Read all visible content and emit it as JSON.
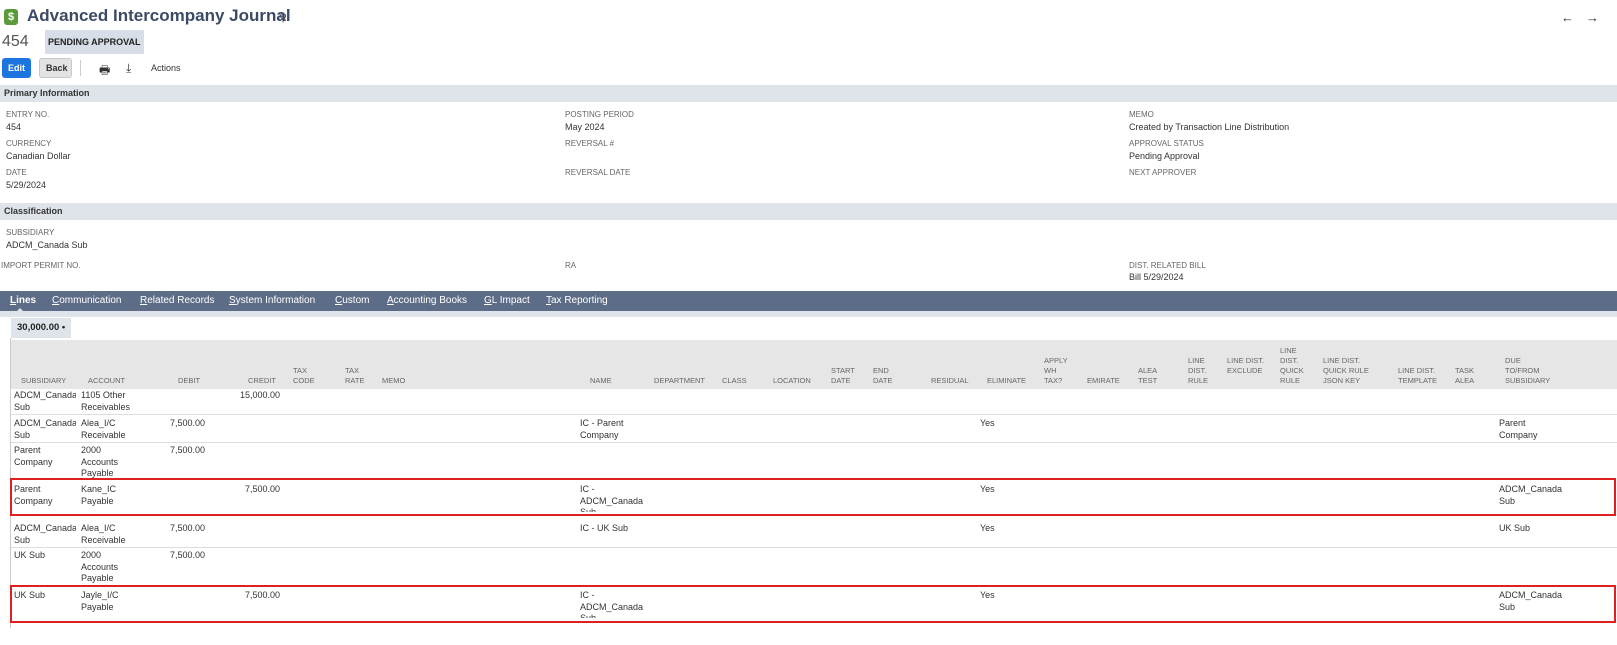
{
  "header": {
    "logo_glyph": "$",
    "title": "Advanced Intercompany Journal",
    "search_glyph": "⚲",
    "nav_arrows": "←→",
    "entry_number": "454",
    "status": "PENDING APPROVAL"
  },
  "toolbar": {
    "edit_label": "Edit",
    "back_label": "Back",
    "print_glyph": "🖶",
    "export_glyph": "⤓",
    "actions_label": "Actions"
  },
  "primary": {
    "section_title": "Primary Information",
    "entry_no_label": "ENTRY NO.",
    "entry_no_value": "454",
    "currency_label": "CURRENCY",
    "currency_value": "Canadian Dollar",
    "date_label": "DATE",
    "date_value": "5/29/2024",
    "posting_period_label": "POSTING PERIOD",
    "posting_period_value": "May 2024",
    "reversal_no_label": "REVERSAL #",
    "reversal_date_label": "REVERSAL DATE",
    "memo_label": "MEMO",
    "memo_value": "Created by Transaction Line Distribution",
    "approval_status_label": "APPROVAL STATUS",
    "approval_status_value": "Pending Approval",
    "next_approver_label": "NEXT APPROVER"
  },
  "classification": {
    "section_title": "Classification",
    "subsidiary_label": "SUBSIDIARY",
    "subsidiary_value": "ADCM_Canada Sub",
    "import_permit_label": "IMPORT PERMIT NO.",
    "ra_label": "RA",
    "dist_bill_label": "DIST. RELATED BILL",
    "dist_bill_value": "Bill 5/29/2024"
  },
  "tabs": [
    {
      "u": "L",
      "rest": "ines"
    },
    {
      "u": "C",
      "rest": "ommunication"
    },
    {
      "u": "R",
      "rest": "elated Records"
    },
    {
      "u": "S",
      "rest": "ystem Information"
    },
    {
      "u": "C",
      "rest": "ustom"
    },
    {
      "u": "A",
      "rest": "ccounting Books"
    },
    {
      "u": "G",
      "rest": "L Impact"
    },
    {
      "u": "T",
      "rest": "ax Reporting"
    }
  ],
  "lines": {
    "subtab_label": "30,000.00 •",
    "columns": {
      "subsidiary": "SUBSIDIARY",
      "account": "ACCOUNT",
      "debit": "DEBIT",
      "credit": "CREDIT",
      "tax_code": "TAX CODE",
      "tax_rate": "TAX RATE",
      "memo": "MEMO",
      "name": "NAME",
      "department": "DEPARTMENT",
      "class": "CLASS",
      "location": "LOCATION",
      "start_date": "START DATE",
      "end_date": "END DATE",
      "residual": "RESIDUAL",
      "eliminate": "ELIMINATE",
      "apply_wh_tax": "APPLY WH TAX?",
      "emirate": "EMIRATE",
      "alea_test": "ALEA TEST",
      "line_dist_rule": "LINE DIST. RULE",
      "line_dist_exclude": "LINE DIST. EXCLUDE",
      "line_dist_quick_rule": "LINE DIST. QUICK RULE",
      "line_dist_json": "LINE DIST. QUICK RULE JSON KEY",
      "line_dist_template": "LINE DIST. TEMPLATE",
      "task_alea": "TASK ALEA",
      "due_to_from": "DUE TO/FROM SUBSIDIARY"
    },
    "rows": [
      {
        "subsidiary": "ADCM_Canada Sub",
        "account": "1105 Other Receivables",
        "debit": "",
        "credit": "15,000.00",
        "name": "",
        "eliminate": "",
        "due": ""
      },
      {
        "subsidiary": "ADCM_Canada Sub",
        "account": "Alea_I/C Receivable",
        "debit": "7,500.00",
        "credit": "",
        "name": "IC - Parent Company",
        "eliminate": "Yes",
        "due": "Parent Company"
      },
      {
        "subsidiary": "Parent Company",
        "account": "2000 Accounts Payable",
        "debit": "7,500.00",
        "credit": "",
        "name": "",
        "eliminate": "",
        "due": ""
      },
      {
        "subsidiary": "Parent Company",
        "account": "Kane_IC Payable",
        "debit": "",
        "credit": "7,500.00",
        "name": "IC - ADCM_Canada Sub",
        "eliminate": "Yes",
        "due": "ADCM_Canada Sub"
      },
      {
        "subsidiary": "ADCM_Canada Sub",
        "account": "Alea_I/C Receivable",
        "debit": "7,500.00",
        "credit": "",
        "name": "IC - UK Sub",
        "eliminate": "Yes",
        "due": "UK Sub"
      },
      {
        "subsidiary": "UK Sub",
        "account": "2000 Accounts Payable",
        "debit": "7,500.00",
        "credit": "",
        "name": "",
        "eliminate": "",
        "due": ""
      },
      {
        "subsidiary": "UK Sub",
        "account": "Jayle_I/C Payable",
        "debit": "",
        "credit": "7,500.00",
        "name": "IC - ADCM_Canada Sub",
        "eliminate": "Yes",
        "due": "ADCM_Canada Sub"
      }
    ]
  },
  "colors": {
    "accent": "#1d75e0",
    "tab_bar": "#5e6d87",
    "section_bar": "#dfe4eb",
    "highlight": "#e02020",
    "link": "#2b5aa8"
  }
}
